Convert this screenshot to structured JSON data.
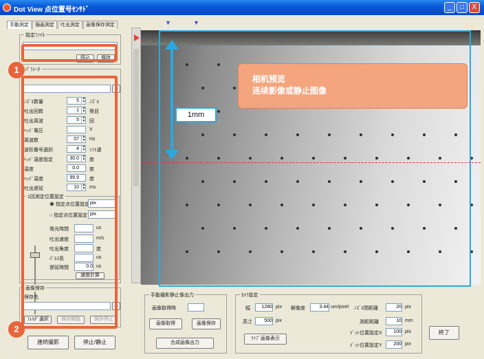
{
  "window": {
    "title": "Dot View 点位置号ｾﾝｻﾄﾞ",
    "min": "_",
    "max": "□",
    "close": "X"
  },
  "tabs": [
    "手動測定",
    "描画測定",
    "吐出測定",
    "画像保存測定"
  ],
  "left": {
    "setting_label": "設定ﾌｧｲﾙ",
    "setting_btn1": "読込",
    "setting_btn2": "保存",
    "section_label": "ﾊﾟﾗﾒｰﾀ",
    "params": [
      {
        "label": "ﾉｽﾞﾙ数量",
        "value": "5",
        "unit": "ﾉｽﾞﾙ"
      },
      {
        "label": "吐出回数",
        "value": "1",
        "unit": "発目"
      },
      {
        "label": "吐出周波",
        "value": "5",
        "unit": "回"
      },
      {
        "label": "ﾍｯﾄﾞ電圧",
        "value": "",
        "unit": "V"
      },
      {
        "label": "周波数",
        "value": "07",
        "unit": "Hz"
      },
      {
        "label": "波形番号選択",
        "value": "4",
        "unit": "ｿﾌﾄ選"
      },
      {
        "label": "ﾍｯﾄﾞ温度設定",
        "value": "30.0",
        "unit": "度"
      },
      {
        "label": "温度",
        "value": "0.0",
        "unit": "度"
      },
      {
        "label": "ﾍｯﾄﾞ温度",
        "value": "99.9",
        "unit": "度"
      },
      {
        "label": "吐出遅延",
        "value": "10",
        "unit": "ms"
      }
    ],
    "measure_group": "1回測定位置設定",
    "radio1": "指定点位置設定",
    "radio1_unit": "pix",
    "radio2": "指定点位置設定",
    "radio2_unit": "pix",
    "results": [
      {
        "label": "発光時間",
        "unit": "us"
      },
      {
        "label": "吐出速度",
        "unit": "m/s"
      },
      {
        "label": "吐出角度",
        "unit": "度"
      },
      {
        "label": "ﾊﾟﾙｽ長",
        "unit": "us"
      },
      {
        "label": "遅延時間",
        "value": "0.0",
        "unit": "us"
      }
    ],
    "calc_btn": "速度計算",
    "history_group": "画像保存",
    "history_label": "保存先",
    "history_btn1": "ﾌｫﾙﾀﾞ選択",
    "history_btn2": "保存開始",
    "history_btn3": "保存停止",
    "bottom_btn1": "連続撮影",
    "bottom_btn2": "停止/静止"
  },
  "center": {
    "group1": "手動撮影静止像出力",
    "img_label": "画像取得時",
    "btn_capture": "画像取得",
    "btn_save": "画像保存",
    "btn_output": "合成画像出力"
  },
  "right": {
    "group2": "ｶﾒﾗ設定",
    "row1_label": "幅",
    "row1_value": "1280",
    "row1_unit": "pix",
    "row1b_label": "解像度",
    "row1b_value": "3.44",
    "row1b_unit": "um/pixel",
    "row1c_label": "ﾉｽﾞﾙ間距離",
    "row1c_value": "20",
    "row1c_unit": "pix",
    "row2_label": "高さ",
    "row2_value": "500",
    "row2_unit": "pix",
    "row2b_label": "測距距離",
    "row2b_value": "10",
    "row2b_unit": "mm",
    "row3b_label": "ﾄﾞｯﾄ位置設定X",
    "row3b_value": "100",
    "row3b_unit": "pix",
    "row4b_label": "ﾄﾞｯﾄ位置設定Y",
    "row4b_value": "200",
    "row4b_unit": "pix",
    "btn_light": "ﾗｲﾌﾞ画像表示",
    "btn_end": "終了"
  },
  "annotations": {
    "badge1": "1",
    "badge2": "2",
    "scale_label": "1mm",
    "callout_line1": "相机预览",
    "callout_line2": "连续影像或静止图像",
    "marker": "▼"
  },
  "colors": {
    "accent": "#e8643c",
    "preview_border": "#29a8e0",
    "guide": "#e83030"
  }
}
